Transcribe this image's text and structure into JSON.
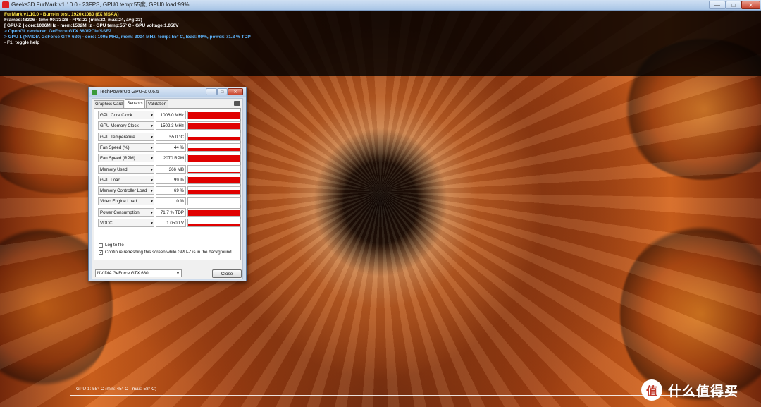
{
  "furmark": {
    "window_title": "Geeks3D FurMark v1.10.0 - 23FPS, GPU0 temp:55度, GPU0 load:99%",
    "window_buttons": {
      "minimize": "—",
      "maximize": "□",
      "close": "✕"
    },
    "osd": {
      "line1": "FurMark v1.10.0 - Burn-in test, 1920x1080 (8X MSAA)",
      "line2": "Frames:48306 - time:00:33:38 - FPS:23 (min:23, max:24, avg:23)",
      "line3": "[ GPU-Z ] core:1006MHz - mem:1502MHz - GPU temp:55° C - GPU voltage:1.050V",
      "line4": "> OpenGL renderer: GeForce GTX 680/PCIe/SSE2",
      "line5": "> GPU 1 (NVIDIA GeForce GTX 680) - core: 1005 MHz, mem: 3004 MHz, temp: 55° C, load: 99%, power: 71.8 % TDP",
      "line6": "- F1: toggle help"
    },
    "graph_label": "GPU 1: 55° C (min: 45° C - max: 58° C)"
  },
  "gpuz": {
    "window_title": "TechPowerUp GPU-Z 0.6.5",
    "window_buttons": {
      "minimize": "—",
      "maximize": "□",
      "close": "✕"
    },
    "tabs": [
      {
        "label": "Graphics Card",
        "active": false
      },
      {
        "label": "Sensors",
        "active": true
      },
      {
        "label": "Validation",
        "active": false
      }
    ],
    "sensors": [
      {
        "name": "GPU Core Clock",
        "value": "1006.0 MHz",
        "level": 0.92
      },
      {
        "name": "GPU Memory Clock",
        "value": "1502.3 MHz",
        "level": 0.92
      },
      {
        "name": "GPU Temperature",
        "value": "55.0 °C",
        "level": 0.45
      },
      {
        "name": "Fan Speed (%)",
        "value": "44 %",
        "level": 0.4
      },
      {
        "name": "Fan Speed (RPM)",
        "value": "2070 RPM",
        "level": 0.92
      },
      {
        "name": "Memory Used",
        "value": "366 MB",
        "level": 0.1
      },
      {
        "name": "GPU Load",
        "value": "99 %",
        "level": 0.92
      },
      {
        "name": "Memory Controller Load",
        "value": "69 %",
        "level": 0.65
      },
      {
        "name": "Video Engine Load",
        "value": "0 %",
        "level": 0
      },
      {
        "name": "Power Consumption",
        "value": "71.7 % TDP",
        "level": 0.75
      },
      {
        "name": "VDDC",
        "value": "1.0500 V",
        "level": 0.3
      }
    ],
    "log_to_file": {
      "label": "Log to file",
      "checked": false
    },
    "continue_refresh": {
      "label": "Continue refreshing this screen while GPU-Z is in the background",
      "checked": true
    },
    "gpu_select": "NVIDIA GeForce GTX 680",
    "close_label": "Close",
    "bar_color": "#e00000"
  },
  "watermark": {
    "icon_text": "值",
    "text": "什么值得买"
  }
}
